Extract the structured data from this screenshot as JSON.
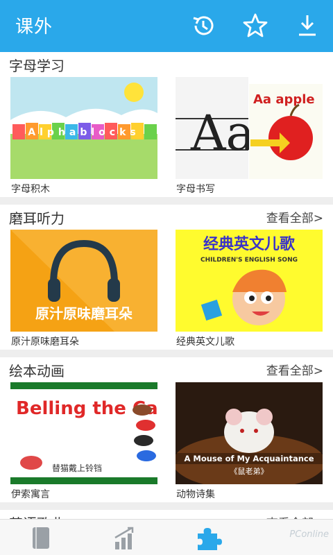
{
  "header": {
    "title": "课外",
    "icons": [
      "history-icon",
      "star-icon",
      "download-icon"
    ]
  },
  "sections": [
    {
      "title": "字母学习",
      "view_all": "",
      "cards": [
        {
          "caption": "字母积木",
          "image_text": "Alphablocks"
        },
        {
          "caption": "字母书写",
          "image_text": "Aa apple"
        }
      ]
    },
    {
      "title": "磨耳听力",
      "view_all": "查看全部>",
      "cards": [
        {
          "caption": "原汁原味磨耳朵",
          "image_text": "原汁原味磨耳朵"
        },
        {
          "caption": "经典英文儿歌",
          "image_text": "经典英文儿歌",
          "image_subtext": "CHILDREN'S ENGLISH SONG"
        }
      ]
    },
    {
      "title": "绘本动画",
      "view_all": "查看全部>",
      "cards": [
        {
          "caption": "伊索寓言",
          "image_text": "Belling the Cat",
          "image_subtext": "替猫戴上铃铛"
        },
        {
          "caption": "动物诗集",
          "image_text": "A Mouse of My Acquaintance",
          "image_subtext": "《鼠老弟》"
        }
      ]
    },
    {
      "title": "英语歌曲",
      "view_all": "查看全部>"
    }
  ],
  "bottom_nav": {
    "tabs": [
      "book-icon",
      "chart-icon",
      "puzzle-icon"
    ],
    "active_tab": "puzzle-icon",
    "watermark": "PConline"
  },
  "colors": {
    "header_bg": "#2aa8ea",
    "active_tab": "#2aa8ea",
    "inactive_tab": "#9aa0a6"
  }
}
